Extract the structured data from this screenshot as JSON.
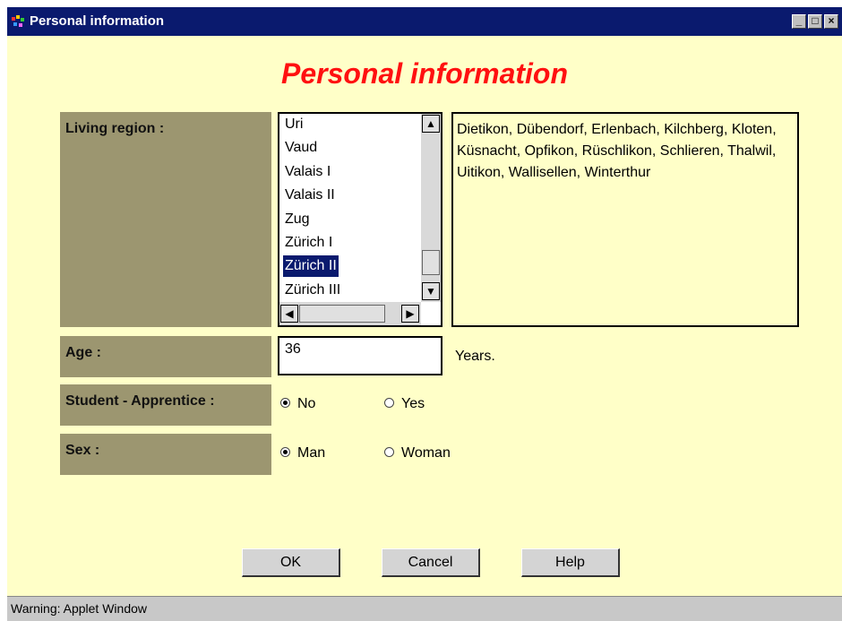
{
  "window": {
    "title": "Personal information",
    "minimize": "_",
    "maximize": "□",
    "close": "×"
  },
  "heading": "Personal information",
  "form": {
    "living_region_label": "Living region :",
    "regions": [
      "Uri",
      "Vaud",
      "Valais I",
      "Valais II",
      "Zug",
      "Zürich I",
      "Zürich II",
      "Zürich III"
    ],
    "selected_region": "Zürich II",
    "region_cities": "Dietikon, Dübendorf, Erlenbach, Kilchberg, Kloten, Küsnacht, Opfikon, Rüschlikon, Schlieren, Thalwil, Uitikon, Wallisellen, Winterthur",
    "age_label": "Age :",
    "age_value": "36",
    "age_unit": "Years.",
    "student_label": "Student - Apprentice :",
    "student_options": [
      {
        "label": "No",
        "checked": true
      },
      {
        "label": "Yes",
        "checked": false
      }
    ],
    "sex_label": "Sex :",
    "sex_options": [
      {
        "label": "Man",
        "checked": true
      },
      {
        "label": "Woman",
        "checked": false
      }
    ]
  },
  "buttons": {
    "ok": "OK",
    "cancel": "Cancel",
    "help": "Help"
  },
  "status": "Warning: Applet Window",
  "colors": {
    "titlebar": "#0a1a6e",
    "background": "#ffffc8",
    "label_bg": "#9c9670",
    "heading": "#ff1010",
    "selection": "#0a1a6e"
  }
}
